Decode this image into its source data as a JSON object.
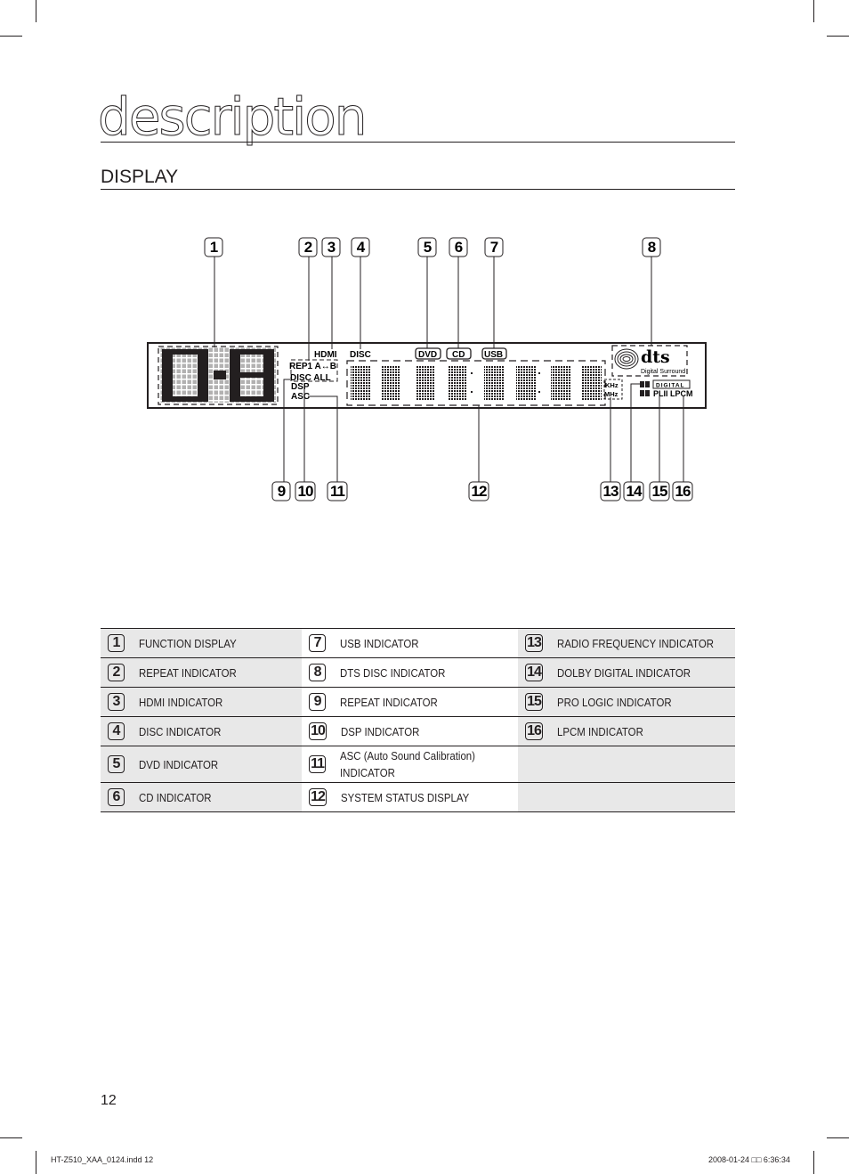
{
  "page": {
    "section_title": "description",
    "subsection_title": "DISPLAY",
    "page_number": "12",
    "footer_left": "HT-Z510_XAA_0124.indd   12",
    "footer_right": "2008-01-24   □□ 6:36:34"
  },
  "display_panel": {
    "labels": {
      "hdmi": "HDMI",
      "disc": "DISC",
      "dvd": "DVD",
      "cd": "CD",
      "usb": "USB",
      "rep1": "REP1 A↔B",
      "disc_all": "DISC  ALL",
      "dsp": "DSP",
      "asc": "ASC",
      "khz": "KHz",
      "mhz": "MHz",
      "dts": "dts",
      "digital_surround": "Digital Surround",
      "digital": "DIGITAL",
      "plii_lpcm": "PLII LPCM"
    },
    "callouts_top": [
      "1",
      "2",
      "3",
      "4",
      "5",
      "6",
      "7",
      "8"
    ],
    "callouts_bottom": [
      "9",
      "10",
      "11",
      "12",
      "13",
      "14",
      "15",
      "16"
    ]
  },
  "legend": {
    "rows": [
      [
        {
          "num": "1",
          "label": "FUNCTION DISPLAY"
        },
        {
          "num": "7",
          "label": "USB INDICATOR"
        },
        {
          "num": "13",
          "label": "RADIO FREQUENCY INDICATOR"
        }
      ],
      [
        {
          "num": "2",
          "label": "REPEAT INDICATOR"
        },
        {
          "num": "8",
          "label": "DTS DISC INDICATOR"
        },
        {
          "num": "14",
          "label": "DOLBY DIGITAL INDICATOR"
        }
      ],
      [
        {
          "num": "3",
          "label": "HDMI INDICATOR"
        },
        {
          "num": "9",
          "label": "REPEAT  INDICATOR"
        },
        {
          "num": "15",
          "label": "PRO LOGIC INDICATOR"
        }
      ],
      [
        {
          "num": "4",
          "label": "DISC INDICATOR"
        },
        {
          "num": "10",
          "label": "DSP INDICATOR"
        },
        {
          "num": "16",
          "label": "LPCM INDICATOR"
        }
      ],
      [
        {
          "num": "5",
          "label": "DVD INDICATOR"
        },
        {
          "num": "11",
          "label": "ASC (Auto Sound Calibration) INDICATOR"
        },
        {
          "num": "",
          "label": ""
        }
      ],
      [
        {
          "num": "6",
          "label": "CD INDICATOR"
        },
        {
          "num": "12",
          "label": "SYSTEM STATUS DISPLAY"
        },
        {
          "num": "",
          "label": ""
        }
      ]
    ]
  }
}
